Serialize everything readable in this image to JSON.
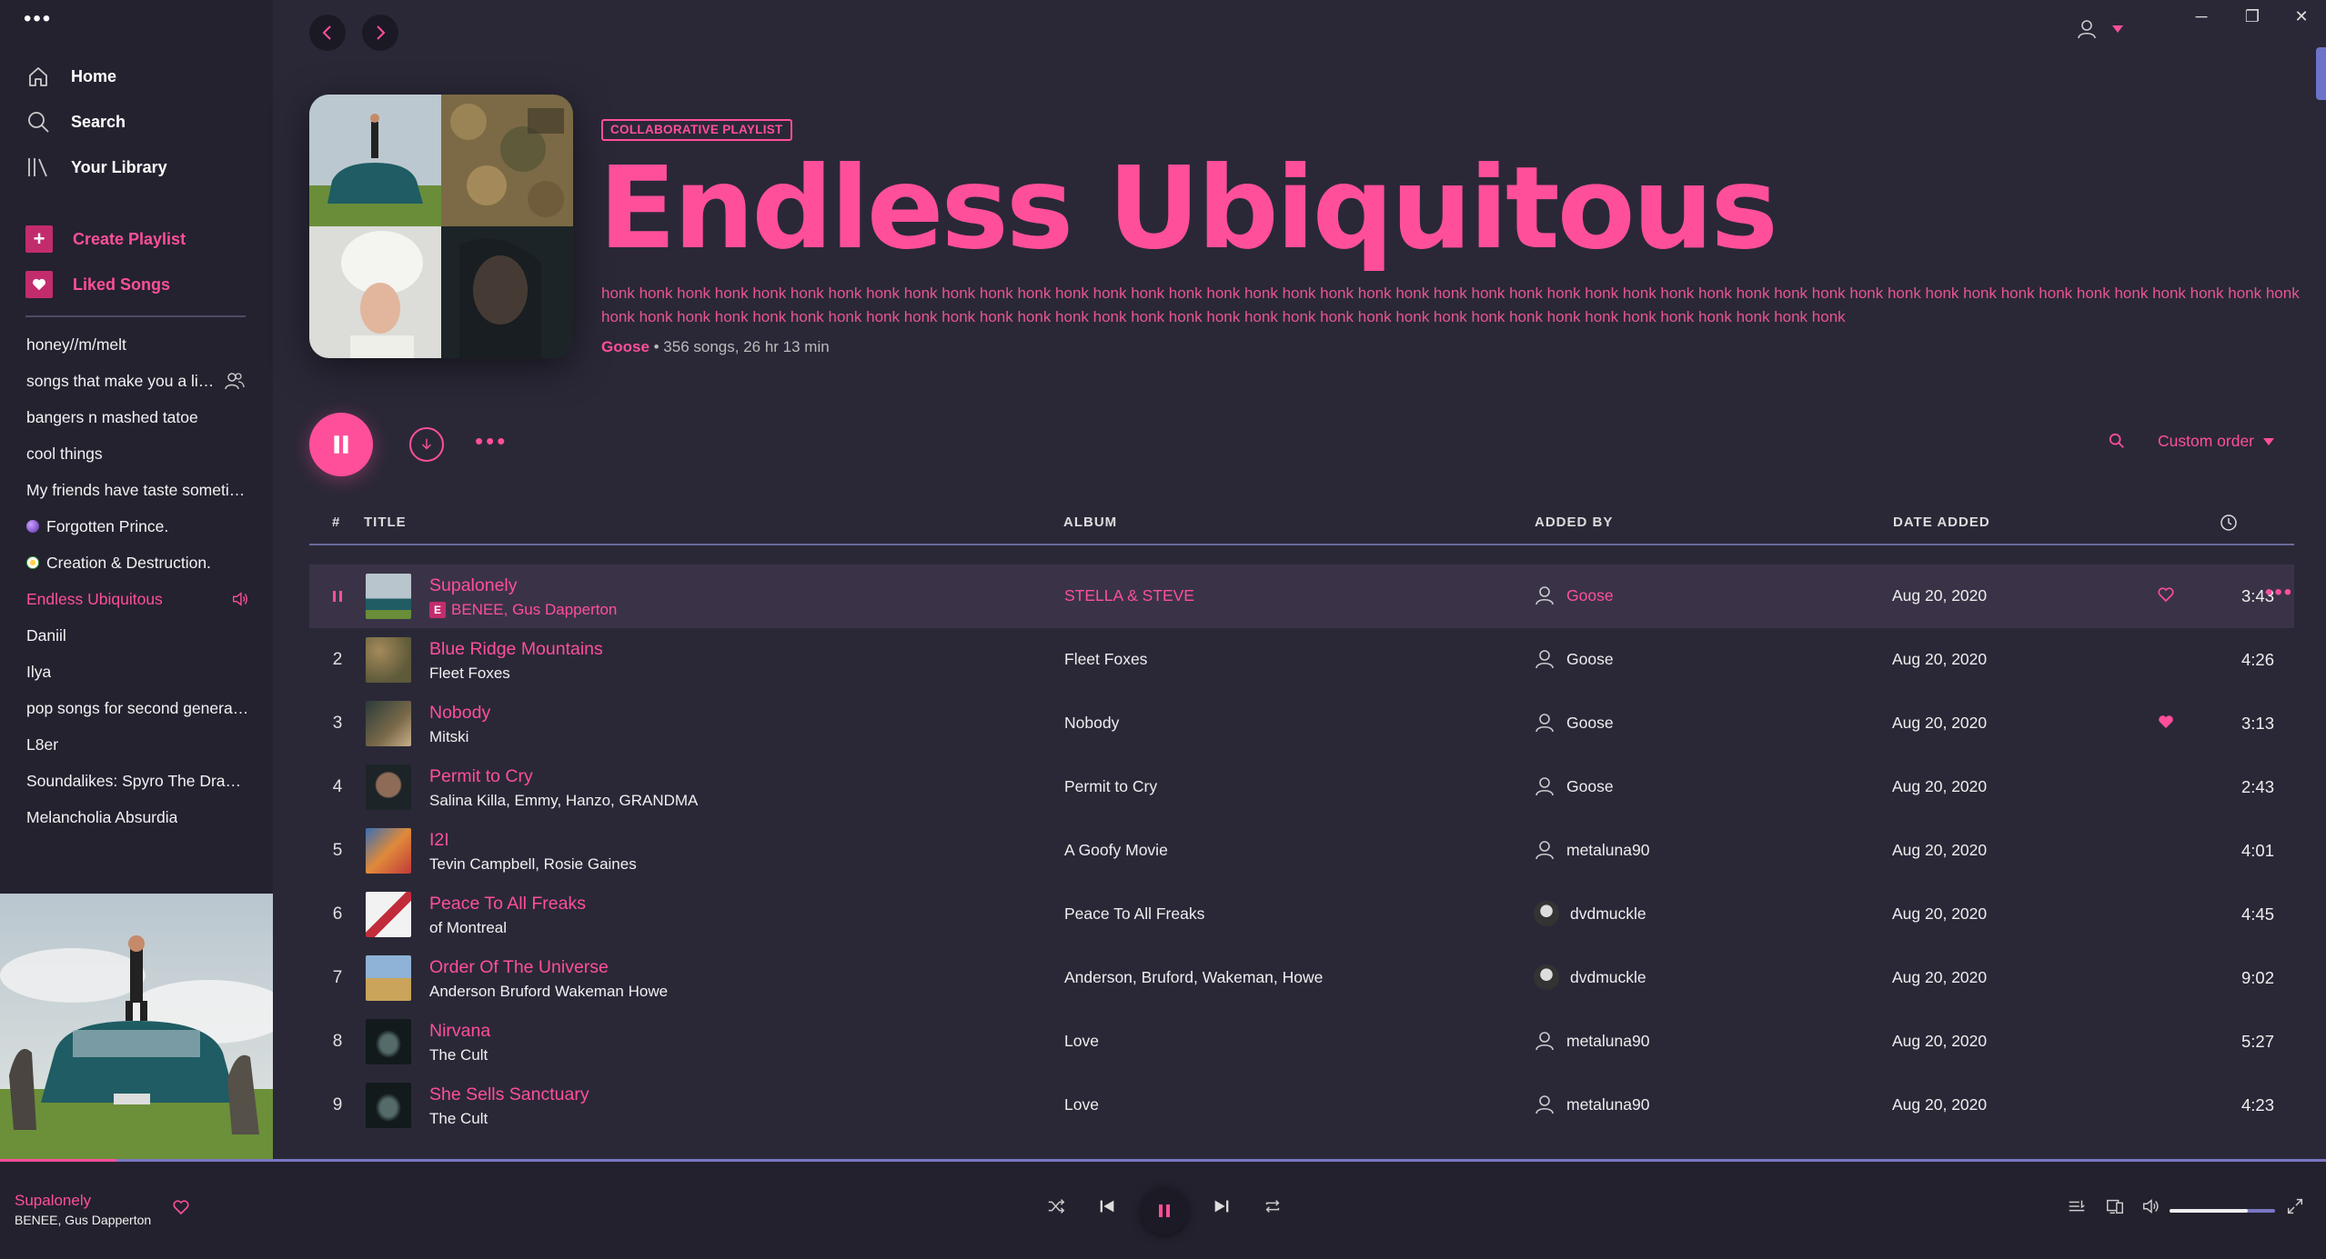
{
  "sidebar": {
    "nav": [
      {
        "label": "Home",
        "icon": "home-icon"
      },
      {
        "label": "Search",
        "icon": "search-icon"
      },
      {
        "label": "Your Library",
        "icon": "library-icon"
      }
    ],
    "actions": [
      {
        "label": "Create Playlist",
        "icon": "plus-icon"
      },
      {
        "label": "Liked Songs",
        "icon": "heart-icon"
      }
    ],
    "playlists": [
      {
        "label": "honey//m/melt"
      },
      {
        "label": "songs that make you a little ill",
        "collab": true
      },
      {
        "label": "bangers n mashed tatoe"
      },
      {
        "label": "cool things"
      },
      {
        "label": "My friends have taste sometimes"
      },
      {
        "label": "Forgotten Prince.",
        "emoji": "purple-orb"
      },
      {
        "label": "Creation & Destruction.",
        "emoji": "flower"
      },
      {
        "label": "Endless Ubiquitous",
        "active": true
      },
      {
        "label": "Daniil"
      },
      {
        "label": "Ilya"
      },
      {
        "label": "pop songs for second generation"
      },
      {
        "label": "L8er"
      },
      {
        "label": "Soundalikes: Spyro The Dragon"
      },
      {
        "label": "Melancholia Absurdia"
      }
    ]
  },
  "header": {
    "badge": "COLLABORATIVE PLAYLIST",
    "title": "Endless Ubiquitous",
    "description": "honk honk honk honk honk honk honk honk honk honk honk honk honk honk honk honk honk honk honk honk honk honk honk honk honk honk honk honk honk honk honk honk honk honk honk honk honk honk honk honk honk honk honk honk honk honk honk honk honk honk honk honk honk honk honk honk honk honk honk honk honk honk honk honk honk honk honk honk honk honk honk honk honk honk honk honk honk honk",
    "owner": "Goose",
    "stats": " • 356 songs, 26 hr 13 min"
  },
  "toolbar": {
    "sort_label": "Custom order"
  },
  "table": {
    "columns": {
      "num": "#",
      "title": "TITLE",
      "album": "ALBUM",
      "added_by": "ADDED BY",
      "date_added": "DATE ADDED"
    },
    "rows": [
      {
        "num": "",
        "title": "Supalonely",
        "artist": "BENEE, Gus Dapperton",
        "explicit": true,
        "album": "STELLA & STEVE",
        "added_by": "Goose",
        "avatar": "user",
        "date": "Aug 20, 2020",
        "duration": "3:43",
        "liked": false,
        "playing": true
      },
      {
        "num": "2",
        "title": "Blue Ridge Mountains",
        "artist": "Fleet Foxes",
        "album": "Fleet Foxes",
        "added_by": "Goose",
        "avatar": "user",
        "date": "Aug 20, 2020",
        "duration": "4:26"
      },
      {
        "num": "3",
        "title": "Nobody",
        "artist": "Mitski",
        "album": "Nobody",
        "added_by": "Goose",
        "avatar": "user",
        "date": "Aug 20, 2020",
        "duration": "3:13",
        "liked": true
      },
      {
        "num": "4",
        "title": "Permit to Cry",
        "artist": "Salina Killa, Emmy, Hanzo, GRANDMA",
        "album": "Permit to Cry",
        "added_by": "Goose",
        "avatar": "user",
        "date": "Aug 20, 2020",
        "duration": "2:43"
      },
      {
        "num": "5",
        "title": "I2I",
        "artist": "Tevin Campbell, Rosie Gaines",
        "album": "A Goofy Movie",
        "added_by": "metaluna90",
        "avatar": "user",
        "date": "Aug 20, 2020",
        "duration": "4:01"
      },
      {
        "num": "6",
        "title": "Peace To All Freaks",
        "artist": "of Montreal",
        "album": "Peace To All Freaks",
        "added_by": "dvdmuckle",
        "avatar": "photo",
        "date": "Aug 20, 2020",
        "duration": "4:45"
      },
      {
        "num": "7",
        "title": "Order Of The Universe",
        "artist": "Anderson Bruford Wakeman Howe",
        "album": "Anderson, Bruford, Wakeman, Howe",
        "added_by": "dvdmuckle",
        "avatar": "photo",
        "date": "Aug 20, 2020",
        "duration": "9:02"
      },
      {
        "num": "8",
        "title": "Nirvana",
        "artist": "The Cult",
        "album": "Love",
        "added_by": "metaluna90",
        "avatar": "user",
        "date": "Aug 20, 2020",
        "duration": "5:27"
      },
      {
        "num": "9",
        "title": "She Sells Sanctuary",
        "artist": "The Cult",
        "album": "Love",
        "added_by": "metaluna90",
        "avatar": "user",
        "date": "Aug 20, 2020",
        "duration": "4:23"
      }
    ]
  },
  "now_playing": {
    "title": "Supalonely",
    "artist": "BENEE, Gus Dapperton",
    "progress": 0.05,
    "volume": 0.74
  },
  "colors": {
    "accent": "#ff4f9a",
    "background": "#2a2837",
    "sidebar": "#24222f",
    "progress_track": "#7a77c4"
  }
}
